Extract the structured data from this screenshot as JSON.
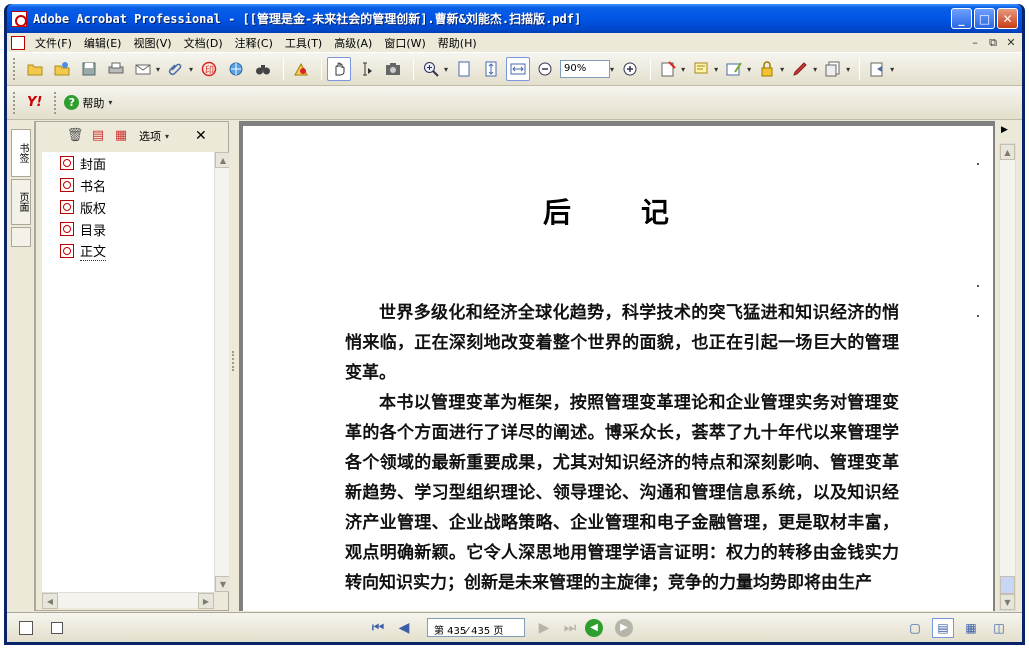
{
  "window": {
    "title": "Adobe Acrobat Professional - [[管理是金-未来社会的管理创新].曹新&刘能杰.扫描版.pdf]",
    "minimize": "_",
    "maximize": "□",
    "close": "✕"
  },
  "menubar": {
    "items": [
      "文件(F)",
      "编辑(E)",
      "视图(V)",
      "文档(D)",
      "注释(C)",
      "工具(T)",
      "高级(A)",
      "窗口(W)",
      "帮助(H)"
    ],
    "mdi_minimize": "–",
    "mdi_restore": "⧉",
    "mdi_close": "✕"
  },
  "toolbar": {
    "zoom_value": "90%"
  },
  "toolbar2": {
    "yahoo_label": "Y!",
    "help_label": "帮助"
  },
  "nav_tabs": {
    "bookmarks": "书签",
    "pages": "页面"
  },
  "bookmarks": {
    "options_label": "选项",
    "close_label": "✕",
    "items": [
      {
        "label": "封面"
      },
      {
        "label": "书名"
      },
      {
        "label": "版权"
      },
      {
        "label": "目录"
      },
      {
        "label": "正文"
      }
    ]
  },
  "document": {
    "heading": "后记",
    "paragraphs": [
      "世界多级化和经济全球化趋势，科学技术的突飞猛进和知识经济的悄悄来临，正在深刻地改变着整个世界的面貌，也正在引起一场巨大的管理变革。",
      "本书以管理变革为框架，按照管理变革理论和企业管理实务对管理变革的各个方面进行了详尽的阐述。博采众长，荟萃了九十年代以来管理学各个领域的最新重要成果，尤其对知识经济的特点和深刻影响、管理变革新趋势、学习型组织理论、领导理论、沟通和管理信息系统，以及知识经济产业管理、企业战略策略、企业管理和电子金融管理，更是取材丰富，观点明确新颖。它令人深思地用管理学语言证明：权力的转移由金钱实力转向知识实力；创新是未来管理的主旋律；竞争的力量均势即将由生产"
    ]
  },
  "statusbar": {
    "page_display": "第 435⁄ 435 页"
  },
  "colors": {
    "titlebar": "#0055e5",
    "chrome": "#ece9d8",
    "doc_background": "#808080"
  }
}
